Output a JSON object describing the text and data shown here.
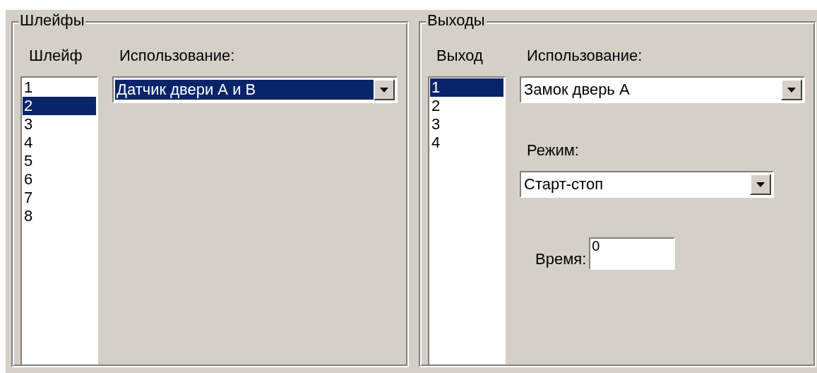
{
  "groups": [
    {
      "title": "Шлейфы",
      "list_heading": "Шлейф",
      "items": [
        {
          "label": "1",
          "selected": false
        },
        {
          "label": "2",
          "selected": true
        },
        {
          "label": "3",
          "selected": false
        },
        {
          "label": "4",
          "selected": false
        },
        {
          "label": "5",
          "selected": false
        },
        {
          "label": "6",
          "selected": false
        },
        {
          "label": "7",
          "selected": false
        },
        {
          "label": "8",
          "selected": false
        }
      ],
      "fields": [
        {
          "kind": "dropdown",
          "label": "Использование:",
          "value": "Датчик двери А и В",
          "focused": true,
          "wide": true
        }
      ]
    },
    {
      "title": "Выходы",
      "list_heading": "Выход",
      "items": [
        {
          "label": "1",
          "selected": true
        },
        {
          "label": "2",
          "selected": false
        },
        {
          "label": "3",
          "selected": false
        },
        {
          "label": "4",
          "selected": false
        }
      ],
      "fields": [
        {
          "kind": "dropdown",
          "label": "Использование:",
          "value": "Замок дверь А",
          "focused": false,
          "wide": true
        },
        {
          "kind": "dropdown",
          "label": "Режим:",
          "value": "Старт-стоп",
          "focused": false,
          "wide": false
        },
        {
          "kind": "text",
          "label": "Время:",
          "value": "0"
        }
      ]
    }
  ]
}
